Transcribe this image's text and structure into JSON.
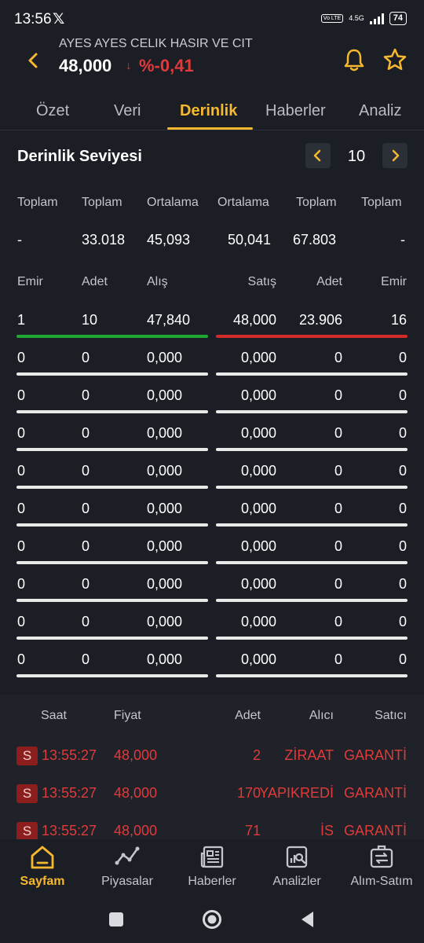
{
  "status": {
    "time": "13:56",
    "net_top": "4.5G",
    "volte": "Vo LTE",
    "battery": "74"
  },
  "header": {
    "stock_name": "AYES AYES CELIK HASIR VE CIT",
    "price": "48,000",
    "change_arrow": "↓",
    "change": "%-0,41"
  },
  "tabs": [
    "Özet",
    "Veri",
    "Derinlik",
    "Haberler",
    "Analiz"
  ],
  "active_tab": "Derinlik",
  "depth": {
    "title": "Derinlik Seviyesi",
    "level": "10"
  },
  "totals": {
    "headers": [
      "Toplam",
      "Toplam",
      "Ortalama",
      "Ortalama",
      "Toplam",
      "Toplam"
    ],
    "values": [
      "-",
      "33.018",
      "45,093",
      "50,041",
      "67.803",
      "-"
    ]
  },
  "book": {
    "headers": [
      "Emir",
      "Adet",
      "Alış",
      "Satış",
      "Adet",
      "Emir"
    ],
    "rows": [
      [
        "1",
        "10",
        "47,840",
        "48,000",
        "23.906",
        "16"
      ],
      [
        "0",
        "0",
        "0,000",
        "0,000",
        "0",
        "0"
      ],
      [
        "0",
        "0",
        "0,000",
        "0,000",
        "0",
        "0"
      ],
      [
        "0",
        "0",
        "0,000",
        "0,000",
        "0",
        "0"
      ],
      [
        "0",
        "0",
        "0,000",
        "0,000",
        "0",
        "0"
      ],
      [
        "0",
        "0",
        "0,000",
        "0,000",
        "0",
        "0"
      ],
      [
        "0",
        "0",
        "0,000",
        "0,000",
        "0",
        "0"
      ],
      [
        "0",
        "0",
        "0,000",
        "0,000",
        "0",
        "0"
      ],
      [
        "0",
        "0",
        "0,000",
        "0,000",
        "0",
        "0"
      ],
      [
        "0",
        "0",
        "0,000",
        "0,000",
        "0",
        "0"
      ]
    ]
  },
  "trades": {
    "headers": [
      "Saat",
      "Fiyat",
      "Adet",
      "Alıcı",
      "Satıcı"
    ],
    "rows": [
      {
        "badge": "S",
        "time": "13:55:27",
        "price": "48,000",
        "qty": "2",
        "buyer": "ZİRAAT",
        "seller": "GARANTİ"
      },
      {
        "badge": "S",
        "time": "13:55:27",
        "price": "48,000",
        "qty": "170",
        "buyer": "YAPIKREDİ",
        "seller": "GARANTİ"
      },
      {
        "badge": "S",
        "time": "13:55:27",
        "price": "48,000",
        "qty": "71",
        "buyer": "İS",
        "seller": "GARANTİ"
      }
    ]
  },
  "bottom_nav": [
    "Sayfam",
    "Piyasalar",
    "Haberler",
    "Analizler",
    "Alım-Satım"
  ],
  "colors": {
    "accent": "#f5b82e",
    "down": "#e03a3a",
    "bid_bar": "#1fa834",
    "ask_bar": "#d42a2a",
    "empty_bar": "#e9e9e9",
    "background": "#1b1e24"
  }
}
